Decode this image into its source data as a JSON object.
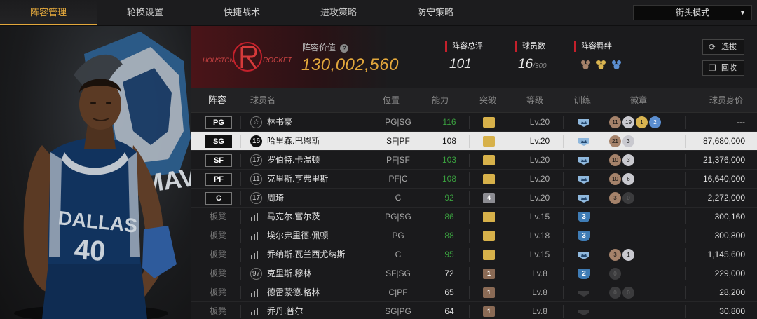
{
  "tabs": [
    {
      "label": "阵容管理",
      "active": true
    },
    {
      "label": "轮换设置",
      "active": false
    },
    {
      "label": "快捷战术",
      "active": false
    },
    {
      "label": "进攻策略",
      "active": false
    },
    {
      "label": "防守策略",
      "active": false
    }
  ],
  "mode_select": {
    "value": "街头模式"
  },
  "player_card": {
    "team_text": "DALLAS",
    "number": "40",
    "logo_text": "MAVERICKS"
  },
  "header": {
    "team_logo_text_left": "HOUSTON",
    "team_logo_text_right": "ROCKETS",
    "value_label": "阵容价值",
    "value": "130,002,560",
    "stats": {
      "rating_label": "阵容总评",
      "rating_value": "101",
      "count_label": "球员数",
      "count_value": "16",
      "count_max": "/300",
      "bond_label": "阵容羁绊"
    },
    "buttons": {
      "select": "选拔",
      "recycle": "回收"
    }
  },
  "table": {
    "columns": [
      "阵容",
      "球员名",
      "位置",
      "能力",
      "突破",
      "等级",
      "训练",
      "徽章",
      "球员身价"
    ],
    "rows": [
      {
        "slot": "PG",
        "bench": false,
        "num": "☆",
        "name": "林书豪",
        "pos": "PG|SG",
        "ability": "116",
        "ability_green": true,
        "break": "gold",
        "break_num": "",
        "level": "Lv.20",
        "train": "crown",
        "train_num": "",
        "badges": [
          {
            "t": "bronze",
            "n": "11"
          },
          {
            "t": "silver",
            "n": "19"
          },
          {
            "t": "gold",
            "n": "1"
          },
          {
            "t": "blue",
            "n": "2"
          }
        ],
        "value": "---",
        "selected": false
      },
      {
        "slot": "SG",
        "bench": false,
        "num": "16",
        "name": "哈里森.巴恩斯",
        "pos": "SF|PF",
        "ability": "108",
        "ability_green": false,
        "break": "gold",
        "break_num": "",
        "level": "Lv.20",
        "train": "crown",
        "train_num": "",
        "badges": [
          {
            "t": "bronze",
            "n": "21"
          },
          {
            "t": "silver",
            "n": "3"
          }
        ],
        "value": "87,680,000",
        "selected": true
      },
      {
        "slot": "SF",
        "bench": false,
        "num": "17",
        "name": "罗伯特.卡温顿",
        "pos": "PF|SF",
        "ability": "103",
        "ability_green": true,
        "break": "gold",
        "break_num": "",
        "level": "Lv.20",
        "train": "crown",
        "train_num": "",
        "badges": [
          {
            "t": "bronze",
            "n": "10"
          },
          {
            "t": "silver",
            "n": "3"
          }
        ],
        "value": "21,376,000",
        "selected": false
      },
      {
        "slot": "PF",
        "bench": false,
        "num": "11",
        "name": "克里斯.亨弗里斯",
        "pos": "PF|C",
        "ability": "108",
        "ability_green": true,
        "break": "gold",
        "break_num": "",
        "level": "Lv.20",
        "train": "crown",
        "train_num": "",
        "badges": [
          {
            "t": "bronze",
            "n": "10"
          },
          {
            "t": "silver",
            "n": "6"
          }
        ],
        "value": "16,640,000",
        "selected": false
      },
      {
        "slot": "C",
        "bench": false,
        "num": "17",
        "name": "周琦",
        "pos": "C",
        "ability": "92",
        "ability_green": true,
        "break": "silver",
        "break_num": "4",
        "level": "Lv.20",
        "train": "crown",
        "train_num": "",
        "badges": [
          {
            "t": "bronze",
            "n": "3"
          },
          {
            "t": "dark",
            "n": "0"
          }
        ],
        "value": "2,272,000",
        "selected": false
      },
      {
        "slot": "板凳",
        "bench": true,
        "num": "bars",
        "name": "马克尔.富尔茨",
        "pos": "PG|SG",
        "ability": "86",
        "ability_green": true,
        "break": "gold",
        "break_num": "",
        "level": "Lv.15",
        "train": "num",
        "train_num": "3",
        "badges": [],
        "value": "300,160",
        "selected": false
      },
      {
        "slot": "板凳",
        "bench": true,
        "num": "bars",
        "name": "埃尔弗里德.佩顿",
        "pos": "PG",
        "ability": "88",
        "ability_green": true,
        "break": "gold",
        "break_num": "",
        "level": "Lv.18",
        "train": "num",
        "train_num": "3",
        "badges": [],
        "value": "300,800",
        "selected": false
      },
      {
        "slot": "板凳",
        "bench": true,
        "num": "bars",
        "name": "乔纳斯.瓦兰西尤纳斯",
        "pos": "C",
        "ability": "95",
        "ability_green": true,
        "break": "gold",
        "break_num": "",
        "level": "Lv.15",
        "train": "crown",
        "train_num": "",
        "badges": [
          {
            "t": "bronze",
            "n": "3"
          },
          {
            "t": "silver",
            "n": "1"
          }
        ],
        "value": "1,145,600",
        "selected": false
      },
      {
        "slot": "板凳",
        "bench": true,
        "num": "97",
        "name": "克里斯.穆林",
        "pos": "SF|SG",
        "ability": "72",
        "ability_green": false,
        "break": "bronze",
        "break_num": "1",
        "level": "Lv.8",
        "train": "num",
        "train_num": "2",
        "badges": [
          {
            "t": "dark",
            "n": "0"
          }
        ],
        "value": "229,000",
        "selected": false
      },
      {
        "slot": "板凳",
        "bench": true,
        "num": "bars",
        "name": "德雷蒙德.格林",
        "pos": "C|PF",
        "ability": "65",
        "ability_green": false,
        "break": "bronze",
        "break_num": "1",
        "level": "Lv.8",
        "train": "dark",
        "train_num": "",
        "badges": [
          {
            "t": "dark",
            "n": "0"
          },
          {
            "t": "dark",
            "n": "0"
          }
        ],
        "value": "28,200",
        "selected": false
      },
      {
        "slot": "板凳",
        "bench": true,
        "num": "bars",
        "name": "乔丹.普尔",
        "pos": "SG|PG",
        "ability": "64",
        "ability_green": false,
        "break": "bronze",
        "break_num": "1",
        "level": "Lv.8",
        "train": "dark",
        "train_num": "",
        "badges": [],
        "value": "30,800",
        "selected": false
      }
    ]
  },
  "colors": {
    "accent": "#e3a83c",
    "red": "#c4202b",
    "green": "#3aa03f",
    "train_blue": "#3f7cb5"
  }
}
